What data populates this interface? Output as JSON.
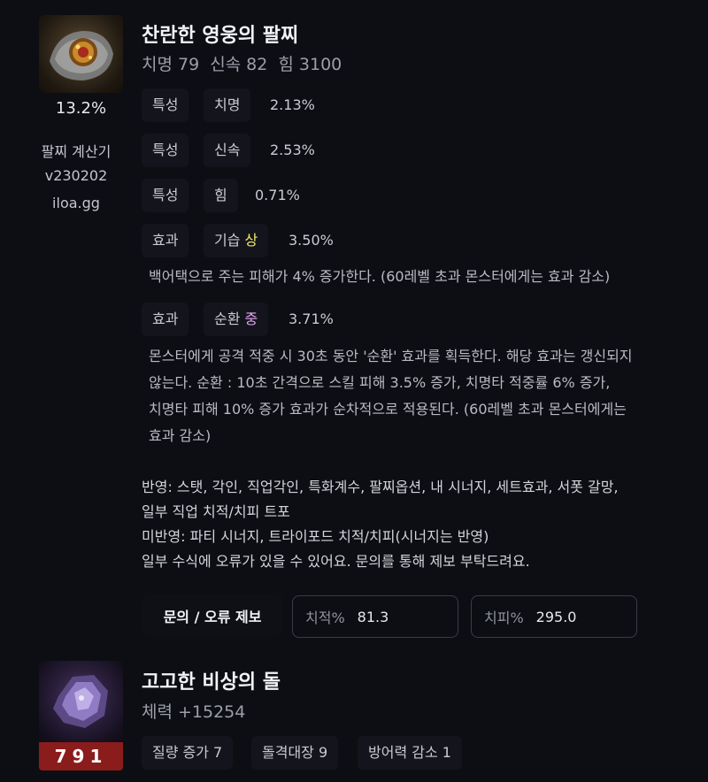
{
  "item": {
    "name": "찬란한 영웅의 팔찌",
    "stats": [
      "치명 79",
      "신속 82",
      "힘 3100"
    ],
    "percent": "13.2%",
    "calculator": {
      "name": "팔찌 계산기",
      "version": "v230202",
      "site": "iloa.gg"
    },
    "rows": [
      {
        "type": "특성",
        "name": "치명",
        "grade": "",
        "value": "2.13%"
      },
      {
        "type": "특성",
        "name": "신속",
        "grade": "",
        "value": "2.53%"
      },
      {
        "type": "특성",
        "name": "힘",
        "grade": "",
        "value": "0.71%"
      },
      {
        "type": "효과",
        "name": "기습",
        "grade": "상",
        "value": "3.50%",
        "desc": [
          "백어택으로 주는 피해가 4% 증가한다. (60레벨 초과 몬스터에게는 효과 감소)"
        ]
      },
      {
        "type": "효과",
        "name": "순환",
        "grade": "중",
        "value": "3.71%",
        "desc": [
          "몬스터에게 공격 적중 시 30초 동안 '순환' 효과를 획득한다. 해당 효과는 갱신되지",
          "않는다. 순환 : 10초 간격으로 스킬 피해 3.5% 증가, 치명타 적중률 6% 증가,",
          "치명타 피해 10% 증가 효과가 순차적으로 적용된다. (60레벨 초과 몬스터에게는",
          "효과 감소)"
        ]
      }
    ],
    "notes": [
      "반영: 스탯, 각인, 직업각인, 특화계수, 팔찌옵션, 내 시너지, 세트효과, 서폿 갈망,",
      "일부 직업 치적/치피 트포",
      "미반영: 파티 시너지, 트라이포드 치적/치피(시너지는 반영)",
      "일부 수식에 오류가 있을 수 있어요. 문의를 통해 제보 부탁드려요."
    ],
    "report_button": "문의 / 오류 제보",
    "crit_rate": {
      "label": "치적%",
      "value": "81.3"
    },
    "crit_dmg": {
      "label": "치피%",
      "value": "295.0"
    }
  },
  "stone": {
    "name": "고고한 비상의 돌",
    "stat": "체력 +15254",
    "code": "791",
    "engravings": [
      "질량 증가 7",
      "돌격대장 9",
      "방어력 감소 1"
    ]
  },
  "colors": {
    "background": "#0d0e13",
    "grade_top": "#f2e96b",
    "grade_mid": "#e6a6f5",
    "stone_bar": "#8b1c1c"
  },
  "icons": {
    "item": "bracelet-icon",
    "stone": "ability-stone-icon"
  }
}
